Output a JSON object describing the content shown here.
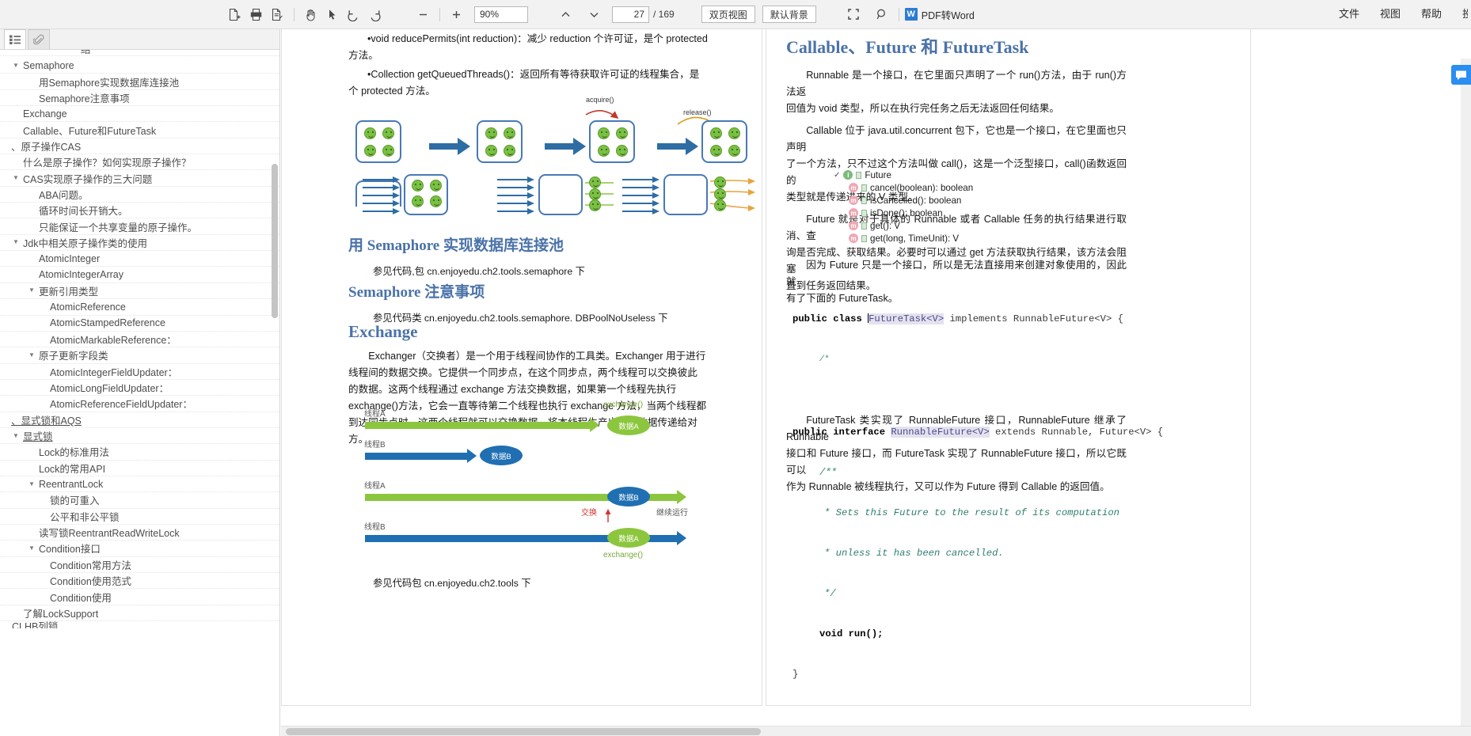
{
  "toolbar": {
    "icons": [
      {
        "name": "export-file-icon",
        "title": "导出"
      },
      {
        "name": "print-icon",
        "title": "打印"
      },
      {
        "name": "save-as-icon",
        "title": "另存为"
      },
      {
        "name": "hand-tool-icon",
        "title": "手型工具"
      },
      {
        "name": "select-tool-icon",
        "title": "选择工具"
      },
      {
        "name": "rotate-left-icon",
        "title": "左旋转"
      },
      {
        "name": "rotate-right-icon",
        "title": "右旋转"
      }
    ],
    "zoom_out_label": "−",
    "zoom_in_label": "+",
    "zoom_value": "90%",
    "prev_page_label": "∧",
    "next_page_label": "∨",
    "current_page": "27",
    "page_total": "/ 169",
    "view_mode": "双页视图",
    "background_mode": "默认背景",
    "fullscreen_icon": "fullscreen-icon",
    "search_icon": "search-icon",
    "pdf_to_word": "PDF转Word",
    "pdf_to_word_badge": "W",
    "menu": [
      "文件",
      "视图",
      "帮助",
      "投"
    ]
  },
  "sidebar": {
    "tabs": [
      {
        "name": "outline-tab",
        "icon": "list-icon",
        "active": true
      },
      {
        "name": "attachment-tab",
        "icon": "paperclip-icon",
        "active": false
      }
    ],
    "partial_top_text": "结",
    "partial_bottom_text": "CLHB列锁",
    "items": [
      {
        "label": "Semaphore",
        "indent": 1,
        "caret": "▼",
        "underline": false
      },
      {
        "label": "用Semaphore实现数据库连接池",
        "indent": 2,
        "caret": "",
        "underline": false
      },
      {
        "label": "Semaphore注意事项",
        "indent": 2,
        "caret": "",
        "underline": false
      },
      {
        "label": "Exchange",
        "indent": 1,
        "caret": "",
        "underline": false
      },
      {
        "label": "Callable、Future和FutureTask",
        "indent": 1,
        "caret": "",
        "underline": false
      },
      {
        "label": "、原子操作CAS",
        "indent": 0,
        "caret": "",
        "underline": false
      },
      {
        "label": "什么是原子操作？如何实现原子操作？",
        "indent": 1,
        "caret": "",
        "underline": false
      },
      {
        "label": "CAS实现原子操作的三大问题",
        "indent": 1,
        "caret": "▼",
        "underline": false
      },
      {
        "label": "ABA问题。",
        "indent": 2,
        "caret": "",
        "underline": false
      },
      {
        "label": "循环时间长开销大。",
        "indent": 2,
        "caret": "",
        "underline": false
      },
      {
        "label": "只能保证一个共享变量的原子操作。",
        "indent": 2,
        "caret": "",
        "underline": false
      },
      {
        "label": "Jdk中相关原子操作类的使用",
        "indent": 1,
        "caret": "▼",
        "underline": false
      },
      {
        "label": "AtomicInteger",
        "indent": 2,
        "caret": "",
        "underline": false
      },
      {
        "label": "AtomicIntegerArray",
        "indent": 2,
        "caret": "",
        "underline": false
      },
      {
        "label": "更新引用类型",
        "indent": 2,
        "caret": "▼",
        "underline": false
      },
      {
        "label": "AtomicReference",
        "indent": 3,
        "caret": "",
        "underline": false
      },
      {
        "label": "AtomicStampedReference",
        "indent": 3,
        "caret": "",
        "underline": false
      },
      {
        "label": "AtomicMarkableReference：",
        "indent": 3,
        "caret": "",
        "underline": false
      },
      {
        "label": "原子更新字段类",
        "indent": 2,
        "caret": "▼",
        "underline": false
      },
      {
        "label": "AtomicIntegerFieldUpdater：",
        "indent": 3,
        "caret": "",
        "underline": false
      },
      {
        "label": "AtomicLongFieldUpdater：",
        "indent": 3,
        "caret": "",
        "underline": false
      },
      {
        "label": "AtomicReferenceFieldUpdater：",
        "indent": 3,
        "caret": "",
        "underline": false
      },
      {
        "label": "、显式锁和AQS",
        "indent": 0,
        "caret": "",
        "underline": true
      },
      {
        "label": "显式锁",
        "indent": 1,
        "caret": "▼",
        "underline": true
      },
      {
        "label": "Lock的标准用法",
        "indent": 2,
        "caret": "",
        "underline": false
      },
      {
        "label": "Lock的常用API",
        "indent": 2,
        "caret": "",
        "underline": false
      },
      {
        "label": "ReentrantLock",
        "indent": 2,
        "caret": "▼",
        "underline": false
      },
      {
        "label": "锁的可重入",
        "indent": 3,
        "caret": "",
        "underline": false
      },
      {
        "label": "公平和非公平锁",
        "indent": 3,
        "caret": "",
        "underline": false
      },
      {
        "label": "读写锁ReentrantReadWriteLock",
        "indent": 2,
        "caret": "",
        "underline": false
      },
      {
        "label": "Condition接口",
        "indent": 2,
        "caret": "▼",
        "underline": false
      },
      {
        "label": "Condition常用方法",
        "indent": 3,
        "caret": "",
        "underline": false
      },
      {
        "label": "Condition使用范式",
        "indent": 3,
        "caret": "",
        "underline": false
      },
      {
        "label": "Condition使用",
        "indent": 3,
        "caret": "",
        "underline": false
      },
      {
        "label": "了解LockSupport",
        "indent": 1,
        "caret": "",
        "underline": false
      }
    ]
  },
  "left_page": {
    "bullet1": "•void reducePermits(int reduction)：减少 reduction 个许可证，是个 protected",
    "bullet1_cont": "方法。",
    "bullet2": "•Collection getQueuedThreads()：返回所有等待获取许可证的线程集合，是",
    "bullet2_cont": "个 protected 方法。",
    "diagram1": {
      "label_acquire": "acquire()",
      "label_release": "release()"
    },
    "heading_semaphore_pool": "用 Semaphore 实现数据库连接池",
    "note_semaphore_pool": "参见代码,包 cn.enjoyedu.ch2.tools.semaphore 下",
    "heading_semaphore_notes": "Semaphore 注意事项",
    "note_semaphore_notes": "参见代码类 cn.enjoyedu.ch2.tools.semaphore. DBPoolNoUseless 下",
    "heading_exchange": "Exchange",
    "exchange_p1": "Exchanger（交换者）是一个用于线程间协作的工具类。Exchanger 用于进行",
    "exchange_p2": "线程间的数据交换。它提供一个同步点，在这个同步点，两个线程可以交换彼此",
    "exchange_p3": "的数据。这两个线程通过 exchange 方法交换数据，如果第一个线程先执行",
    "exchange_p4": "exchange()方法，它会一直等待第二个线程也执行 exchange 方法，当两个线程都",
    "exchange_p5": "到达同步点时，这两个线程就可以交换数据，将本线程生产出来的数据传递给对",
    "exchange_p6": "方。",
    "diagram2": {
      "thread_a": "线程A",
      "thread_b": "线程B",
      "data_a": "数据A",
      "data_b": "数据B",
      "exchange_top": "exchange()",
      "exchange_bottom": "exchange()",
      "swap_label": "交换",
      "continue_label": "继续运行",
      "thread_a2": "线程A",
      "thread_b2": "线程B"
    },
    "note_exchange": "参见代码包 cn.enjoyedu.ch2.tools 下"
  },
  "right_page": {
    "heading": "Callable、Future 和 FutureTask",
    "p1_l1": "Runnable 是一个接口，在它里面只声明了一个 run()方法，由于 run()方法返",
    "p1_l2": "回值为 void 类型，所以在执行完任务之后无法返回任何结果。",
    "p2_l1": "Callable 位于 java.util.concurrent 包下，它也是一个接口，在它里面也只声明",
    "p2_l2": "了一个方法，只不过这个方法叫做 call()，这是一个泛型接口，call()函数返回的",
    "p2_l3": "类型就是传递进来的 V 类型。",
    "p3_l1": "Future 就是对于具体的 Runnable 或者 Callable 任务的执行结果进行取消、查",
    "p3_l2": "询是否完成、获取结果。必要时可以通过 get 方法获取执行结果，该方法会阻塞",
    "p3_l3": "直到任务返回结果。",
    "tree": [
      {
        "kind": "interface",
        "badge": "I",
        "label": "Future",
        "level": 0,
        "checked": true
      },
      {
        "kind": "method",
        "badge": "m",
        "label": "cancel(boolean): boolean",
        "level": 1,
        "checked": false
      },
      {
        "kind": "method",
        "badge": "m",
        "label": "isCancelled(): boolean",
        "level": 1,
        "checked": false
      },
      {
        "kind": "method",
        "badge": "m",
        "label": "isDone(): boolean",
        "level": 1,
        "checked": false
      },
      {
        "kind": "method",
        "badge": "m",
        "label": "get(): V",
        "level": 1,
        "checked": false
      },
      {
        "kind": "method",
        "badge": "m",
        "label": "get(long, TimeUnit): V",
        "level": 1,
        "checked": false
      }
    ],
    "p4_l1": "因为 Future 只是一个接口，所以是无法直接用来创建对象使用的，因此就",
    "p4_l2": "有了下面的 FutureTask。",
    "code": {
      "line1_kw": "public class ",
      "line1_type": "FutureTask<V>",
      "line1_rest": " implements RunnableFuture<V> {",
      "line2": "/*",
      "line3_kw": "public interface ",
      "line3_type": "RunnableFuture<V>",
      "line3_rest": " extends Runnable, Future<V> {",
      "line4": "/**",
      "line5": "* Sets this Future to the result of its computation",
      "line6": "* unless it has been cancelled.",
      "line7": "*/",
      "line8": "void run();",
      "line9": "}"
    },
    "p5_l1": "FutureTask 类实现了 RunnableFuture 接口，RunnableFuture 继承了 Runnable",
    "p5_l2": "接口和 Future 接口，而 FutureTask 实现了 RunnableFuture 接口，所以它既可以",
    "p5_l3": "作为 Runnable 被线程执行，又可以作为 Future 得到 Callable 的返回值。"
  },
  "float_widget": {
    "icon": "chat-bubble-icon"
  }
}
